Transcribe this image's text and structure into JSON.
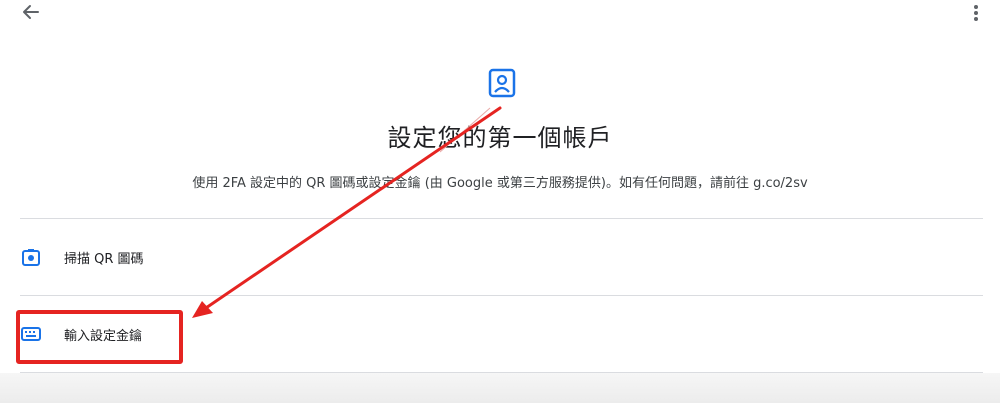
{
  "header": {
    "back_icon": "arrow-back-icon",
    "more_icon": "more-vert-icon"
  },
  "main": {
    "icon": "account-box-icon",
    "title": "設定您的第一個帳戶",
    "subtitle": "使用 2FA 設定中的 QR 圖碼或設定金鑰 (由 Google 或第三方服務提供)。如有任何問題，請前往 g.co/2sv"
  },
  "options": [
    {
      "label": "掃描 QR 圖碼",
      "icon": "camera-icon"
    },
    {
      "label": "輸入設定金鑰",
      "icon": "keyboard-icon"
    }
  ],
  "colors": {
    "accent_blue": "#1a73e8",
    "annotation_red": "#e52421",
    "divider": "#dadce0"
  }
}
